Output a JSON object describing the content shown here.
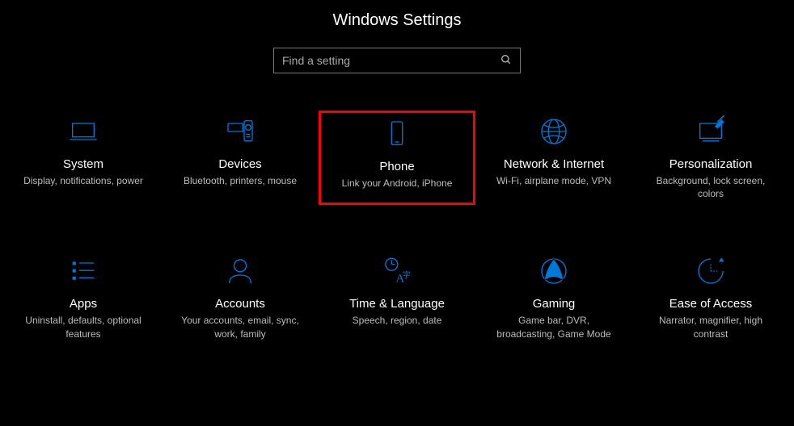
{
  "header": {
    "title": "Windows Settings"
  },
  "search": {
    "placeholder": "Find a setting"
  },
  "tiles": {
    "system": {
      "title": "System",
      "desc": "Display, notifications, power"
    },
    "devices": {
      "title": "Devices",
      "desc": "Bluetooth, printers, mouse"
    },
    "phone": {
      "title": "Phone",
      "desc": "Link your Android, iPhone"
    },
    "network": {
      "title": "Network & Internet",
      "desc": "Wi-Fi, airplane mode, VPN"
    },
    "personalization": {
      "title": "Personalization",
      "desc": "Background, lock screen, colors"
    },
    "apps": {
      "title": "Apps",
      "desc": "Uninstall, defaults, optional features"
    },
    "accounts": {
      "title": "Accounts",
      "desc": "Your accounts, email, sync, work, family"
    },
    "time": {
      "title": "Time & Language",
      "desc": "Speech, region, date"
    },
    "gaming": {
      "title": "Gaming",
      "desc": "Game bar, DVR, broadcasting, Game Mode"
    },
    "ease": {
      "title": "Ease of Access",
      "desc": "Narrator, magnifier, high contrast"
    }
  },
  "highlighted_tile": "phone",
  "colors": {
    "accent": "#0078d7",
    "highlight": "#ff0000"
  }
}
